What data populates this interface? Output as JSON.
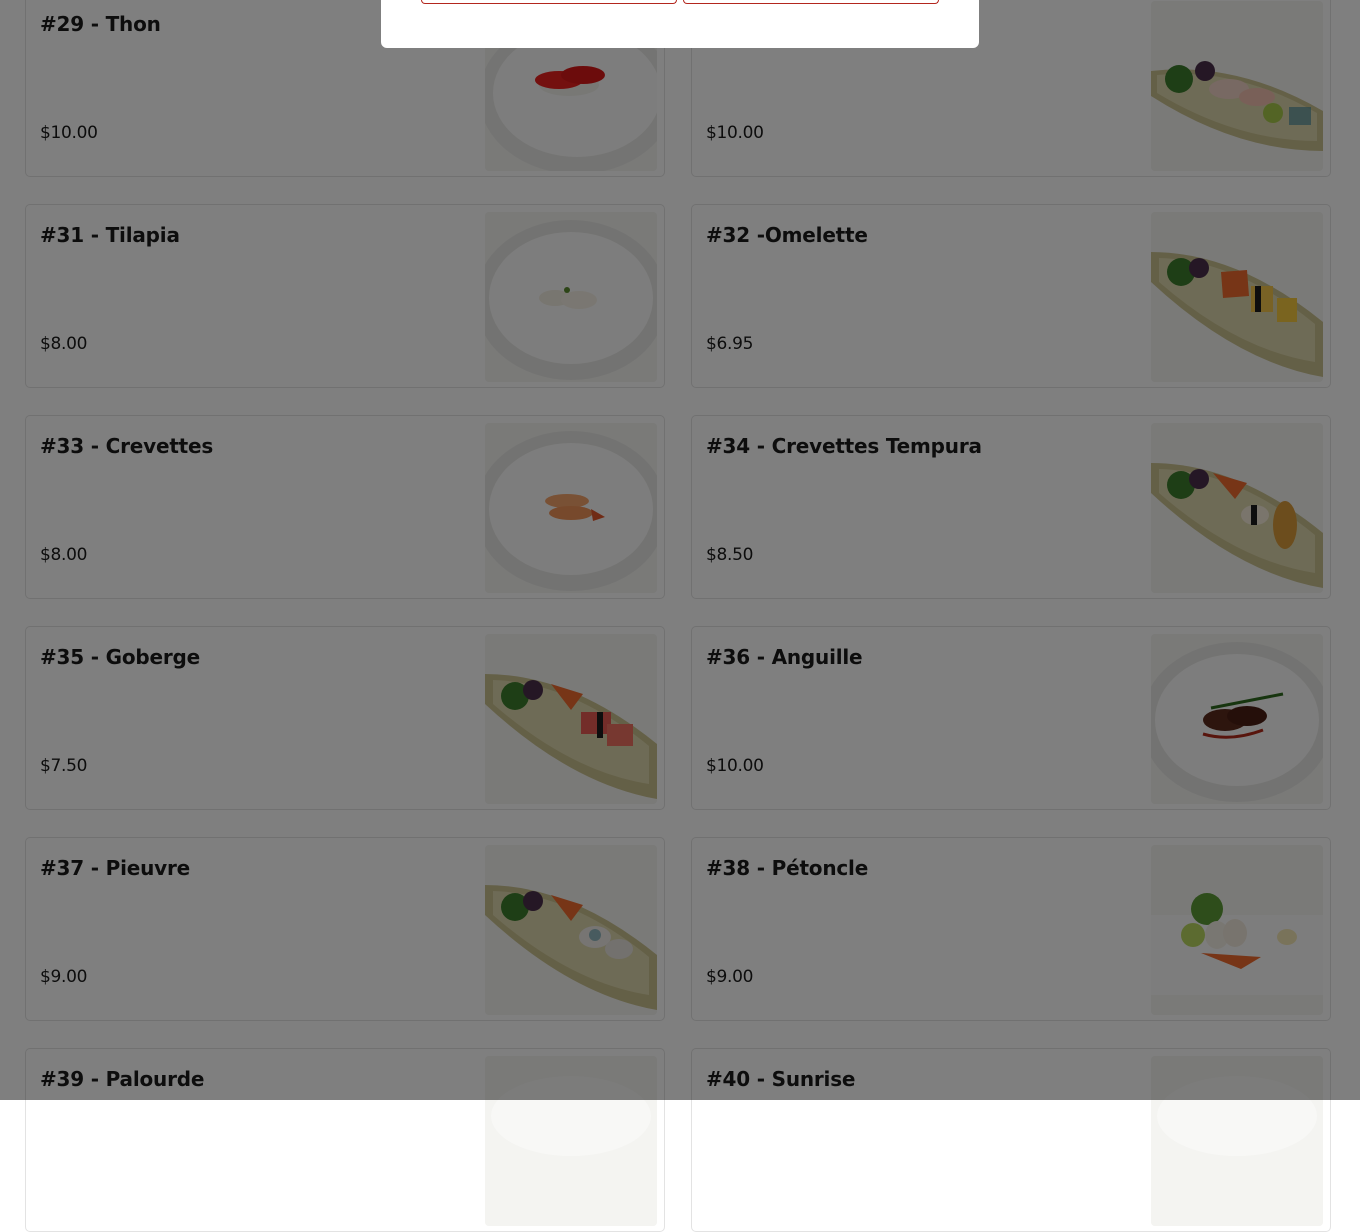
{
  "menu": {
    "items": [
      {
        "name": "#29 - Thon",
        "price": "$10.00",
        "photo": "tuna-nigiri-plate"
      },
      {
        "name": "",
        "price": "$10.00",
        "photo": "sashimi-boat"
      },
      {
        "name": "#31 - Tilapia",
        "price": "$8.00",
        "photo": "tilapia-nigiri-plate"
      },
      {
        "name": "#32 -Omelette",
        "price": "$6.95",
        "photo": "omelette-nigiri-boat"
      },
      {
        "name": "#33 - Crevettes",
        "price": "$8.00",
        "photo": "shrimp-nigiri-plate"
      },
      {
        "name": "#34 - Crevettes Tempura",
        "price": "$8.50",
        "photo": "tempura-shrimp-boat"
      },
      {
        "name": "#35 - Goberge",
        "price": "$7.50",
        "photo": "crab-stick-nigiri-boat"
      },
      {
        "name": "#36 - Anguille",
        "price": "$10.00",
        "photo": "eel-nigiri-plate"
      },
      {
        "name": "#37 - Pieuvre",
        "price": "$9.00",
        "photo": "octopus-nigiri-boat"
      },
      {
        "name": "#38 - Pétoncle",
        "price": "$9.00",
        "photo": "scallop-sashimi-plate"
      },
      {
        "name": "#39 - Palourde",
        "price": "",
        "photo": "clam-nigiri"
      },
      {
        "name": "#40 - Sunrise",
        "price": "",
        "photo": "sunrise-nigiri"
      }
    ]
  },
  "colors": {
    "overlay": "rgba(0,0,0,0.5)",
    "modal_button_border": "#b3261e",
    "card_border": "#e3e3e3"
  }
}
